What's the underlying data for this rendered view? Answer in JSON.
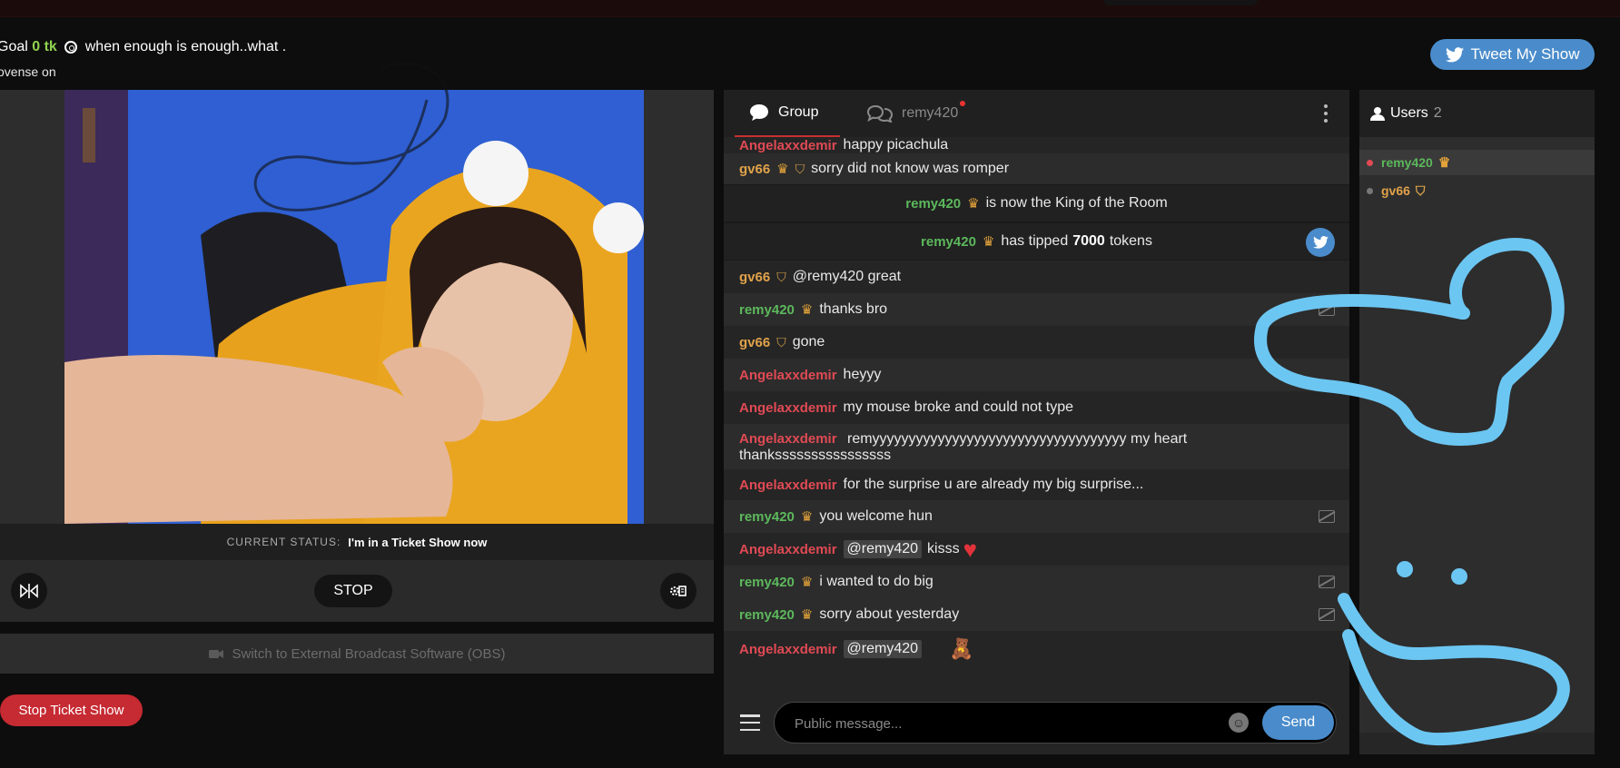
{
  "header": {
    "goal_prefix": "Goal",
    "goal_amount": "0 tk",
    "goal_text": "when enough is enough..what .",
    "subline": "ovense on",
    "tweet_button": "Tweet My Show"
  },
  "video": {
    "status_label": "CURRENT STATUS:",
    "status_value": "I'm in a Ticket Show now",
    "stop_button": "STOP",
    "obs_label": "Switch to External Broadcast Software (OBS)",
    "stop_ticket_button": "Stop Ticket Show"
  },
  "chat": {
    "tab_group": "Group",
    "tab_private": "remy420",
    "messages": [
      {
        "user": "Angelaxxdemir",
        "text": "happy picachula"
      },
      {
        "user": "gv66",
        "text": "sorry did not know was romper"
      },
      {
        "user": "remy420",
        "text": "is now the King of the Room"
      },
      {
        "user": "remy420",
        "text_before": "has tipped",
        "amount": "7000",
        "text_after": "tokens"
      },
      {
        "user": "gv66",
        "text": "@remy420  great"
      },
      {
        "user": "remy420",
        "text": "thanks bro"
      },
      {
        "user": "gv66",
        "text": "gone"
      },
      {
        "user": "Angelaxxdemir",
        "text": "heyyy"
      },
      {
        "user": "Angelaxxdemir",
        "text": "my mouse broke and could not type"
      },
      {
        "user": "Angelaxxdemir",
        "text": "remyyyyyyyyyyyyyyyyyyyyyyyyyyyyyyyyyyy my heart",
        "text2": "thankssssssssssssssss"
      },
      {
        "user": "Angelaxxdemir",
        "text": "for the surprise u are already my big surprise..."
      },
      {
        "user": "remy420",
        "text": "you welcome hun"
      },
      {
        "user": "Angelaxxdemir",
        "mention": "@remy420",
        "text": "kisss"
      },
      {
        "user": "remy420",
        "text": "i wanted to do big"
      },
      {
        "user": "remy420",
        "text": "sorry about yesterday"
      },
      {
        "user": "Angelaxxdemir",
        "mention": "@remy420"
      }
    ],
    "placeholder": "Public message...",
    "send_button": "Send"
  },
  "users": {
    "title": "Users",
    "count": "2",
    "list": [
      {
        "name": "remy420"
      },
      {
        "name": "gv66"
      }
    ]
  },
  "colors": {
    "accent_blue": "#4a8ccb",
    "danger_red": "#c62a32",
    "user_red": "#e04a54",
    "user_green": "#5cb85c",
    "user_gold": "#e0a24a",
    "marker_overlay": "#6cc6f2"
  }
}
